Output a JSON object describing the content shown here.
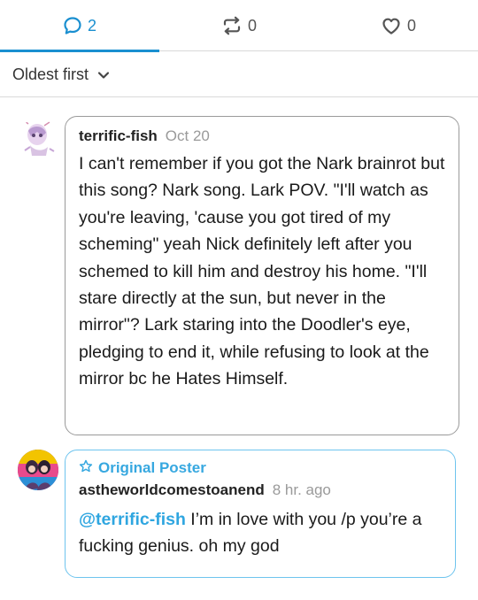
{
  "tabs": {
    "replies": {
      "count": "2",
      "icon": "speech-bubble-icon"
    },
    "reblogs": {
      "count": "0",
      "icon": "reblog-icon"
    },
    "likes": {
      "count": "0",
      "icon": "heart-icon"
    }
  },
  "sort": {
    "label": "Oldest first",
    "icon": "chevron-down-icon"
  },
  "comments": [
    {
      "username": "terrific-fish",
      "date": "Oct 20",
      "text": "I can't remember if you got the Nark brainrot but this song? Nark song. Lark POV. \"I'll watch as you're leaving, 'cause you got tired of my scheming\" yeah Nick definitely left after you schemed to kill him and destroy his home. \"I'll stare directly at the sun, but never in the mirror\"? Lark staring into the Doodler's eye, pledging to end it, while refusing to look at the mirror bc he Hates Himself."
    },
    {
      "badge": "Original Poster",
      "username": "astheworldcomestoanend",
      "date": "8 hr. ago",
      "mention": "@terrific-fish",
      "text": " I’m in love with you /p you’re a fucking genius. oh my god"
    }
  ],
  "colors": {
    "accent": "#1a8fd0",
    "op_border": "#6ec4ee",
    "muted": "#9a9a9a"
  }
}
